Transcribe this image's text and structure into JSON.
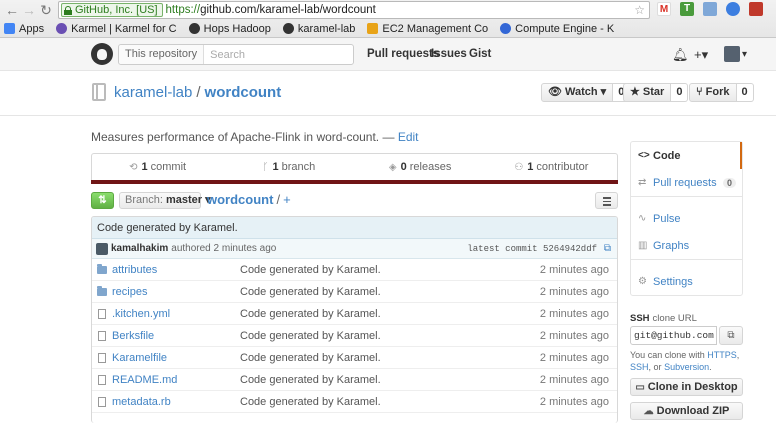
{
  "browser": {
    "ssl_label": "GitHub, Inc. [US]",
    "url_scheme": "https://",
    "url_rest": "github.com/karamel-lab/wordcount",
    "bookmarks": [
      {
        "label": "Apps",
        "color": "#4285f4"
      },
      {
        "label": "Karmel | Karmel for C",
        "color": "#6a4fb3"
      },
      {
        "label": "Hops Hadoop",
        "color": "#333333"
      },
      {
        "label": "karamel-lab",
        "color": "#333333"
      },
      {
        "label": "EC2 Management Co",
        "color": "#e8a317"
      },
      {
        "label": "Compute Engine - K",
        "color": "#3367d6"
      }
    ],
    "extensions": [
      {
        "label": "M",
        "color": "#d93025"
      },
      {
        "label": "T",
        "color": "#4a9b3c"
      },
      {
        "label": "",
        "color": "#7fa8d8"
      },
      {
        "label": "",
        "color": "#3c7ee0"
      },
      {
        "label": "",
        "color": "#c0392b"
      }
    ]
  },
  "header": {
    "search_scope": "This repository",
    "search_placeholder": "Search",
    "nav": [
      "Pull requests",
      "Issues",
      "Gist"
    ],
    "bell_icon": "bell-icon",
    "plus_label": "+▾",
    "avatar_caret": "▾"
  },
  "repo": {
    "owner": "karamel-lab",
    "separator": "/",
    "name": "wordcount",
    "watch_label": "Watch ▾",
    "watch_count": "0",
    "star_label": "Star",
    "star_count": "0",
    "fork_label": "Fork",
    "fork_count": "0",
    "description": "Measures performance of Apache-Flink in word-count.",
    "edit_sep": "—",
    "edit_label": "Edit",
    "language_color": "#701516"
  },
  "summary": {
    "commits_num": "1",
    "commits_label": "commit",
    "branches_num": "1",
    "branches_label": "branch",
    "releases_num": "0",
    "releases_label": "releases",
    "contributors_num": "1",
    "contributors_label": "contributor"
  },
  "filenav": {
    "compare_icon": "⇅",
    "branch_label": "Branch:",
    "branch_value": "master ▾",
    "breadcrumb_repo": "wordcount",
    "breadcrumb_slash": "/",
    "breadcrumb_plus": "+"
  },
  "commit": {
    "title": "Code generated by Karamel.",
    "author": "kamalhakim",
    "authored": "authored 2 minutes ago",
    "latest": "latest commit 5264942ddf"
  },
  "files": [
    {
      "name": "attributes",
      "type": "dir",
      "message": "Code generated by Karamel.",
      "age": "2 minutes ago"
    },
    {
      "name": "recipes",
      "type": "dir",
      "message": "Code generated by Karamel.",
      "age": "2 minutes ago"
    },
    {
      "name": ".kitchen.yml",
      "type": "file",
      "message": "Code generated by Karamel.",
      "age": "2 minutes ago"
    },
    {
      "name": "Berksfile",
      "type": "file",
      "message": "Code generated by Karamel.",
      "age": "2 minutes ago"
    },
    {
      "name": "Karamelfile",
      "type": "file",
      "message": "Code generated by Karamel.",
      "age": "2 minutes ago"
    },
    {
      "name": "README.md",
      "type": "file",
      "message": "Code generated by Karamel.",
      "age": "2 minutes ago"
    },
    {
      "name": "metadata.rb",
      "type": "file",
      "message": "Code generated by Karamel.",
      "age": "2 minutes ago"
    }
  ],
  "sidebar": {
    "code": "Code",
    "pulls": "Pull requests",
    "pulls_count": "0",
    "pulse": "Pulse",
    "graphs": "Graphs",
    "settings": "Settings"
  },
  "clone": {
    "proto": "SSH",
    "label": "clone URL",
    "value": "git@github.com:karamel-lab/wordcount.git",
    "help_prefix": "You can clone with",
    "https": "HTTPS",
    "ssh": "SSH",
    "help_or": "or",
    "subversion": "Subversion",
    "desktop_label": "Clone in Desktop",
    "zip_label": "Download ZIP"
  }
}
